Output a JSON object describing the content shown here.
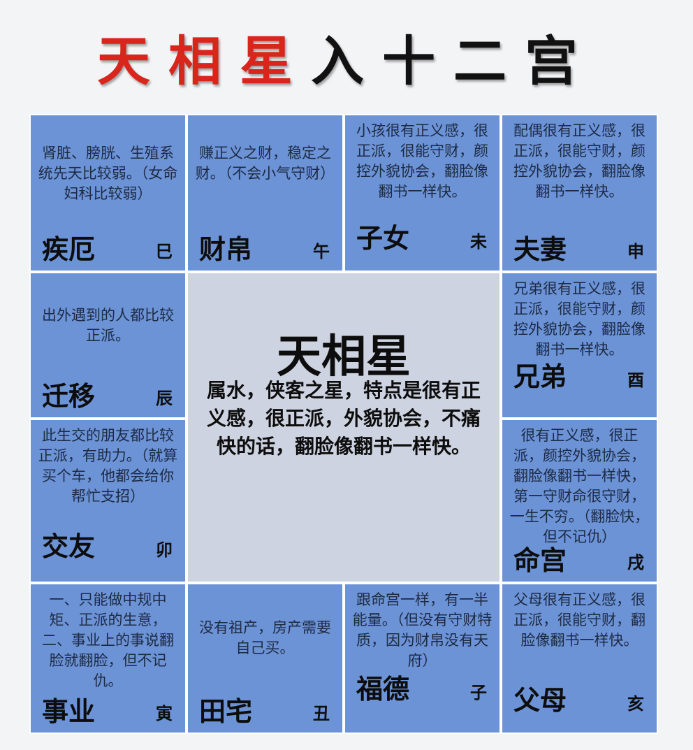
{
  "title": {
    "red": "天相星",
    "black": "入十二宫"
  },
  "center": {
    "star": "天相星",
    "desc": "属水，侠客之星，特点是很有正义感，很正派，外貌协会，不痛快的话，翻脸像翻书一样快。"
  },
  "palaces": {
    "jie": {
      "name": "疾厄",
      "branch": "巳",
      "text": "肾脏、膀胱、生殖系统先天比较弱。（女命妇科比较弱）"
    },
    "cai": {
      "name": "财帛",
      "branch": "午",
      "text": "赚正义之财，稳定之财。（不会小气守财）"
    },
    "zi": {
      "name": "子女",
      "branch": "未",
      "text": "小孩很有正义感，很正派，很能守财，颜控外貌协会，翻脸像翻书一样快。"
    },
    "fu": {
      "name": "夫妻",
      "branch": "申",
      "text": "配偶很有正义感，很正派，很能守财，颜控外貌协会，翻脸像翻书一样快。"
    },
    "qian": {
      "name": "迁移",
      "branch": "辰",
      "text": "出外遇到的人都比较正派。"
    },
    "xiong": {
      "name": "兄弟",
      "branch": "酉",
      "text": "兄弟很有正义感，很正派，很能守财，颜控外貌协会，翻脸像翻书一样快。"
    },
    "jiao": {
      "name": "交友",
      "branch": "卯",
      "text": "此生交的朋友都比较正派，有助力。（就算买个车，他都会给你帮忙支招）"
    },
    "ming": {
      "name": "命宫",
      "branch": "戌",
      "text": "很有正义感，很正派，颜控外貌协会，翻脸像翻书一样快，第一守财命很守财，一生不穷。（翻脸快，但不记仇）"
    },
    "shi": {
      "name": "事业",
      "branch": "寅",
      "text": "一、只能做中规中矩、正派的生意，二、事业上的事说翻脸就翻脸，但不记仇。"
    },
    "tian": {
      "name": "田宅",
      "branch": "丑",
      "text": "没有祖产，房产需要自己买。"
    },
    "fude": {
      "name": "福德",
      "branch": "子",
      "text": "跟命宫一样，有一半能量。（但没有守财特质，因为财帛没有天府）"
    },
    "fumu": {
      "name": "父母",
      "branch": "亥",
      "text": "父母很有正义感，很正派，很能守财，翻脸像翻书一样快。"
    }
  }
}
